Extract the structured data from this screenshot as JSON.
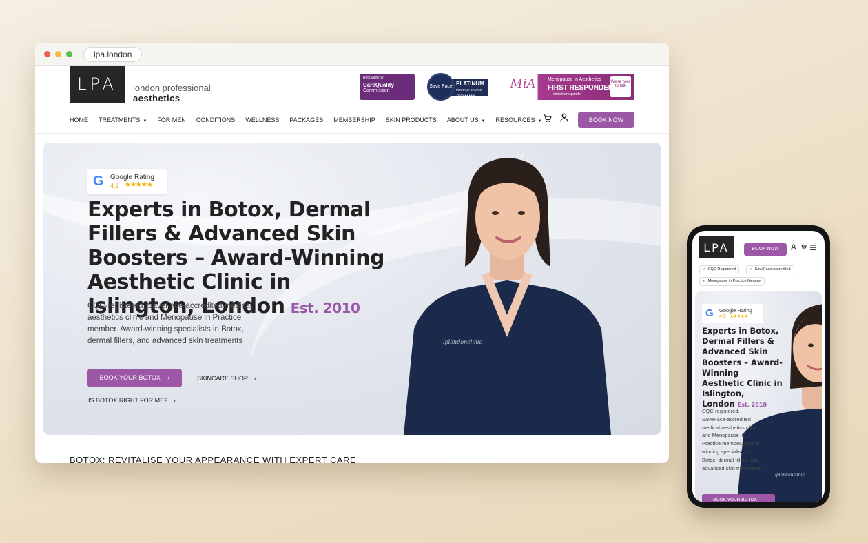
{
  "browser": {
    "url": "lpa.london"
  },
  "header": {
    "logo_mark": "LPA",
    "logo_line1": "london professional",
    "logo_line2": "aesthetics",
    "badges": {
      "cqc_small": "Regulated by",
      "cqc_name1": "CareQuality",
      "cqc_name2": "Commission",
      "saveface_circle": "Save Face",
      "saveface_line1": "PLATINUM",
      "saveface_line2": "PROFILE STATUS",
      "saveface_line3": "2026 • • • • •",
      "menopause_logo": "MiA",
      "menopause_line1": "Menopause in Aesthetics",
      "menopause_line2": "FIRST RESPONDER",
      "menopause_line3": "#miafirstresponder",
      "menopause_talk": "We're here to talk"
    }
  },
  "nav": {
    "items": [
      {
        "label": "HOME",
        "dropdown": false
      },
      {
        "label": "TREATMENTS",
        "dropdown": true
      },
      {
        "label": "FOR MEN",
        "dropdown": false
      },
      {
        "label": "CONDITIONS",
        "dropdown": false
      },
      {
        "label": "WELLNESS",
        "dropdown": false
      },
      {
        "label": "PACKAGES",
        "dropdown": false
      },
      {
        "label": "MEMBERSHIP",
        "dropdown": false
      },
      {
        "label": "SKIN PRODUCTS",
        "dropdown": false
      },
      {
        "label": "ABOUT US",
        "dropdown": true
      },
      {
        "label": "RESOURCES",
        "dropdown": true
      }
    ],
    "book_now": "BOOK NOW",
    "cart_icon": "cart-icon",
    "user_icon": "user-icon"
  },
  "hero": {
    "rating_label": "Google Rating",
    "rating_score": "4.9",
    "rating_stars": "★★★★★",
    "title": "Experts in Botox, Dermal Fillers & Advanced Skin Boosters – Award-Winning Aesthetic Clinic in Islington, London",
    "est": "Est. 2010",
    "description": "CQC-registered, SaveFace-accredited medical aesthetics clinic and Menopause in Practice member. Award-winning specialists in Botox, dermal fillers, and advanced skin treatments",
    "cta_primary": "BOOK YOUR BOTOX",
    "cta_secondary": "SKINCARE SHOP",
    "cta_tertiary": "IS BOTOX RIGHT FOR ME?",
    "uniform_text": "lplondonclinic"
  },
  "below_fold": {
    "section_title": "BOTOX: REVITALISE YOUR APPEARANCE WITH EXPERT CARE"
  },
  "mobile": {
    "logo_mark": "LPA",
    "book_now": "BOOK NOW",
    "chips": [
      "CQC Registered",
      "SaveFace Accredited",
      "Menopause in Practice Member"
    ],
    "rating_label": "Google Rating",
    "rating_score": "4.9",
    "rating_stars": "★★★★★",
    "title": "Experts in Botox, Dermal Fillers & Advanced Skin Boosters – Award-Winning Aesthetic Clinic in Islington, London",
    "est": "Est. 2010",
    "description": "CQC-registered, SaveFace-accredited medical aesthetics clinic and Menopause in Practice member. Award-winning specialists in Botox, dermal fillers, and advanced skin treatments",
    "cta_primary": "BOOK YOUR BOTOX"
  },
  "colors": {
    "accent": "#9c57a7",
    "logo_bg": "#262626",
    "scrubs": "#1b2a4a",
    "background": "#ecdfc6"
  }
}
